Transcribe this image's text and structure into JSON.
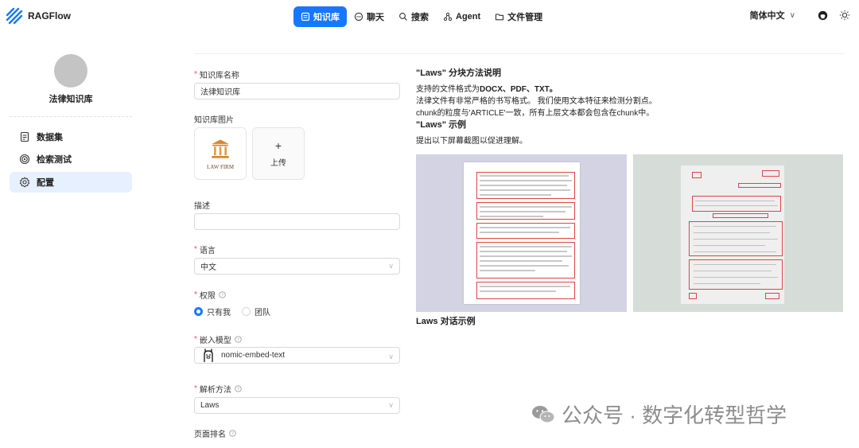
{
  "app": {
    "name": "RAGFlow"
  },
  "nav": [
    {
      "label": "知识库",
      "icon": "database-icon",
      "active": true
    },
    {
      "label": "聊天",
      "icon": "chat-icon",
      "active": false
    },
    {
      "label": "搜索",
      "icon": "search-icon",
      "active": false
    },
    {
      "label": "Agent",
      "icon": "agent-icon",
      "active": false
    },
    {
      "label": "文件管理",
      "icon": "folder-icon",
      "active": false
    }
  ],
  "header_right": {
    "language": "简体中文",
    "language_chevron": "∨"
  },
  "sidebar": {
    "kb_name": "法律知识库",
    "items": [
      {
        "label": "数据集",
        "icon": "file-icon"
      },
      {
        "label": "检索测试",
        "icon": "target-icon"
      },
      {
        "label": "配置",
        "icon": "gear-icon"
      }
    ]
  },
  "form": {
    "name_label": "知识库名称",
    "name_value": "法律知识库",
    "image_label": "知识库图片",
    "image_logo_text": "LAW FIRM",
    "upload_plus": "+",
    "upload_label": "上传",
    "desc_label": "描述",
    "desc_value": "",
    "language_label": "语言",
    "language_value": "中文",
    "permission_label": "权限",
    "permission_options": [
      "只有我",
      "团队"
    ],
    "permission_selected": "只有我",
    "embed_label": "嵌入模型",
    "embed_value": "nomic-embed-text",
    "parse_label": "解析方法",
    "parse_value": "Laws",
    "page_rank_label": "页面排名"
  },
  "method_desc": {
    "title": "\"Laws\" 分块方法说明",
    "line1_prefix": "支持的文件格式为",
    "line1_formats": "DOCX、PDF、TXT。",
    "line2": "法律文件有非常严格的书写格式。 我们使用文本特征来检测分割点。",
    "line3": "chunk的粒度与'ARTICLE'一致，所有上层文本都会包含在chunk中。",
    "example_title": "\"Laws\" 示例",
    "example_desc": "提出以下屏幕截图以促进理解。",
    "dialog_title": "Laws 对话示例"
  },
  "watermark": "公众号 · 数字化转型哲学",
  "colors": {
    "accent": "#1677ff",
    "required": "#ff4d4f",
    "active_side_bg": "#e6f0ff"
  }
}
